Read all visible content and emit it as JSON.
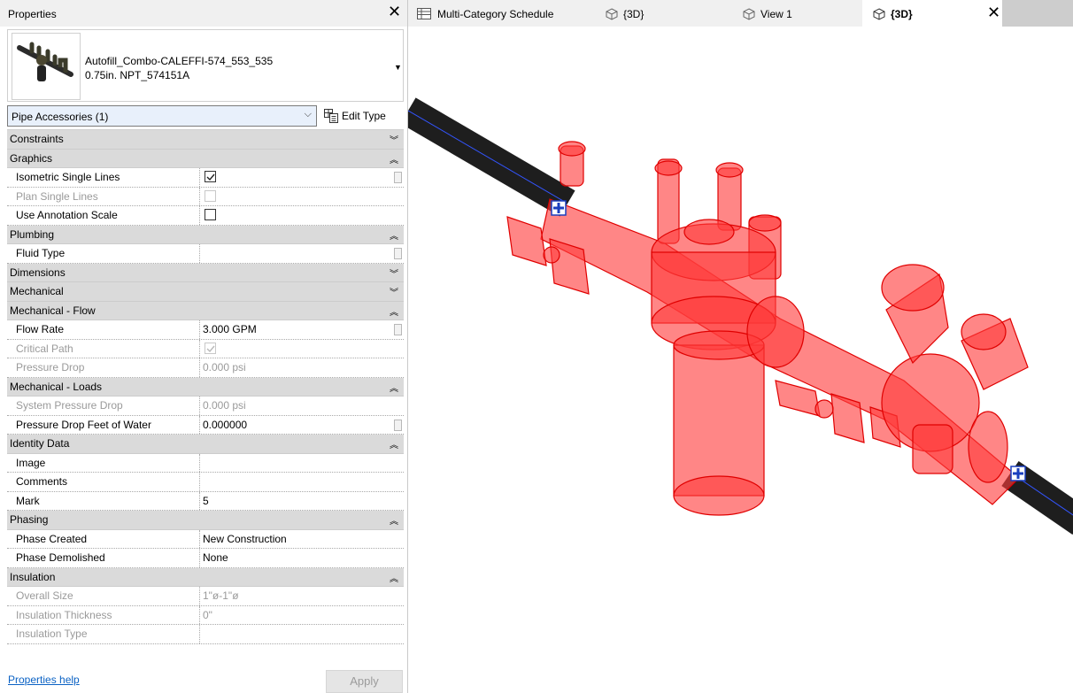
{
  "properties": {
    "title": "Properties",
    "type_name_line1": "Autofill_Combo-CALEFFI-574_553_535",
    "type_name_line2": "0.75in. NPT_574151A",
    "filter": "Pipe Accessories (1)",
    "edit_type": "Edit Type",
    "help": "Properties help",
    "apply": "Apply",
    "rows": [
      {
        "kind": "cat",
        "label": "Constraints",
        "expanded": false
      },
      {
        "kind": "cat",
        "label": "Graphics",
        "expanded": true
      },
      {
        "kind": "check",
        "name": "Isometric Single Lines",
        "checked": true,
        "enabled": true
      },
      {
        "kind": "check",
        "name": "Plan Single Lines",
        "checked": false,
        "enabled": false
      },
      {
        "kind": "check",
        "name": "Use Annotation Scale",
        "checked": false,
        "enabled": true
      },
      {
        "kind": "cat",
        "label": "Plumbing",
        "expanded": true
      },
      {
        "kind": "prop",
        "name": "Fluid Type",
        "value": "",
        "enabled": true
      },
      {
        "kind": "cat",
        "label": "Dimensions",
        "expanded": false
      },
      {
        "kind": "cat",
        "label": "Mechanical",
        "expanded": false
      },
      {
        "kind": "cat",
        "label": "Mechanical - Flow",
        "expanded": true
      },
      {
        "kind": "prop",
        "name": "Flow Rate",
        "value": "3.000 GPM",
        "enabled": true
      },
      {
        "kind": "check",
        "name": "Critical Path",
        "checked": true,
        "enabled": false
      },
      {
        "kind": "prop",
        "name": "Pressure Drop",
        "value": "0.000 psi",
        "enabled": false
      },
      {
        "kind": "cat",
        "label": "Mechanical - Loads",
        "expanded": true
      },
      {
        "kind": "prop",
        "name": "System Pressure Drop",
        "value": "0.000 psi",
        "enabled": false
      },
      {
        "kind": "prop",
        "name": "Pressure Drop Feet of Water",
        "value": "0.000000",
        "enabled": true
      },
      {
        "kind": "cat",
        "label": "Identity Data",
        "expanded": true
      },
      {
        "kind": "prop",
        "name": "Image",
        "value": "",
        "enabled": true
      },
      {
        "kind": "prop",
        "name": "Comments",
        "value": "",
        "enabled": true
      },
      {
        "kind": "prop",
        "name": "Mark",
        "value": "5",
        "enabled": true
      },
      {
        "kind": "cat",
        "label": "Phasing",
        "expanded": true
      },
      {
        "kind": "prop",
        "name": "Phase Created",
        "value": "New Construction",
        "enabled": true
      },
      {
        "kind": "prop",
        "name": "Phase Demolished",
        "value": "None",
        "enabled": true
      },
      {
        "kind": "cat",
        "label": "Insulation",
        "expanded": true
      },
      {
        "kind": "prop",
        "name": "Overall Size",
        "value": "1\"ø-1\"ø",
        "enabled": false
      },
      {
        "kind": "prop",
        "name": "Insulation Thickness",
        "value": "0\"",
        "enabled": false
      },
      {
        "kind": "prop",
        "name": "Insulation Type",
        "value": "",
        "enabled": false
      }
    ]
  },
  "tabs": [
    {
      "label": "Multi-Category Schedule",
      "icon": "schedule-icon",
      "active": false
    },
    {
      "label": "{3D}",
      "icon": "3d-view-icon",
      "active": false
    },
    {
      "label": "View 1",
      "icon": "3d-view-icon",
      "active": false
    },
    {
      "label": "{3D}",
      "icon": "3d-view-icon",
      "active": true
    }
  ],
  "colors": {
    "selection": "#ff2020",
    "pipe": "#1e1e1e",
    "pipe_centerline": "#3355ff",
    "link": "#0b62c4"
  }
}
